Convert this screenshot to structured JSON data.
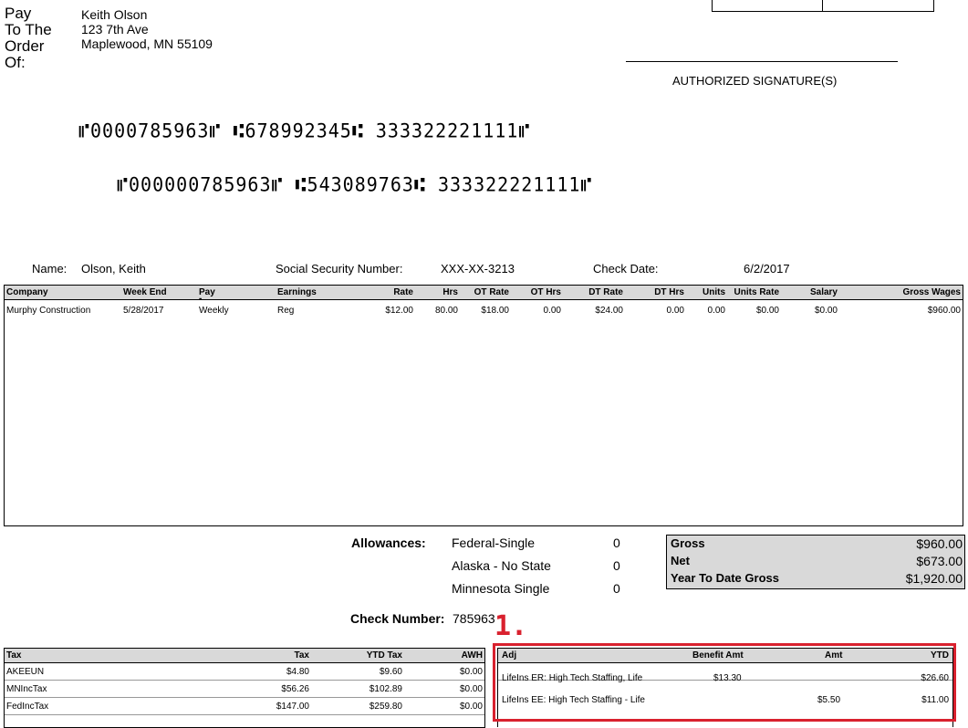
{
  "payee": {
    "label_lines": [
      "Pay",
      "To The",
      "Order",
      "Of:"
    ],
    "name": "Keith  Olson",
    "address1": "123 7th Ave",
    "address2": "Maplewood, MN  55109"
  },
  "signature": {
    "label": "AUTHORIZED SIGNATURE(S)"
  },
  "micr": {
    "line1": "⑈0000785963⑈ ⑆678992345⑆ 333322221111⑈",
    "line2": "⑈000000785963⑈ ⑆543089763⑆ 333322221111⑈"
  },
  "employee": {
    "name_label": "Name:",
    "name": "Olson, Keith",
    "ssn_label": "Social Security Number:",
    "ssn": "XXX-XX-3213",
    "check_date_label": "Check Date:",
    "check_date": "6/2/2017"
  },
  "earnings": {
    "headers": [
      "Company",
      "Week End",
      "Pay",
      "Earnings",
      "Rate",
      "Hrs",
      "OT Rate",
      "OT Hrs",
      "DT Rate",
      "DT Hrs",
      "Units",
      "Units Rate",
      "Salary",
      "Gross Wages"
    ],
    "pay_marker": "-",
    "row": [
      "Murphy Construction",
      "5/28/2017",
      "Weekly",
      "Reg",
      "$12.00",
      "80.00",
      "$18.00",
      "0.00",
      "$24.00",
      "0.00",
      "0.00",
      "$0.00",
      "$0.00",
      "$960.00"
    ]
  },
  "allowances": {
    "label": "Allowances:",
    "items": [
      {
        "name": "Federal-Single",
        "value": "0"
      },
      {
        "name": "Alaska - No State",
        "value": "0"
      },
      {
        "name": "Minnesota Single",
        "value": "0"
      }
    ]
  },
  "totals": [
    {
      "label": "Gross",
      "value": "$960.00"
    },
    {
      "label": "Net",
      "value": "$673.00"
    },
    {
      "label": "Year To Date Gross",
      "value": "$1,920.00"
    }
  ],
  "check_number": {
    "label": "Check Number:",
    "value": "785963"
  },
  "taxes": {
    "headers": [
      "Tax",
      "Tax",
      "YTD Tax",
      "AWH"
    ],
    "rows": [
      [
        "AKEEUN",
        "$4.80",
        "$9.60",
        "$0.00"
      ],
      [
        "MNIncTax",
        "$56.26",
        "$102.89",
        "$0.00"
      ],
      [
        "FedIncTax",
        "$147.00",
        "$259.80",
        "$0.00"
      ]
    ]
  },
  "adjustments": {
    "headers": [
      "Adj",
      "Benefit Amt",
      "Amt",
      "YTD"
    ],
    "rows": [
      [
        "LifeIns ER: High Tech Staffing, Life",
        "$13.30",
        "",
        "$26.60"
      ],
      [
        "LifeIns EE: High Tech Staffing  - Life",
        "",
        "$5.50",
        "$11.00"
      ]
    ]
  },
  "annotation": {
    "marker": "1.",
    "color": "#d9212e"
  }
}
